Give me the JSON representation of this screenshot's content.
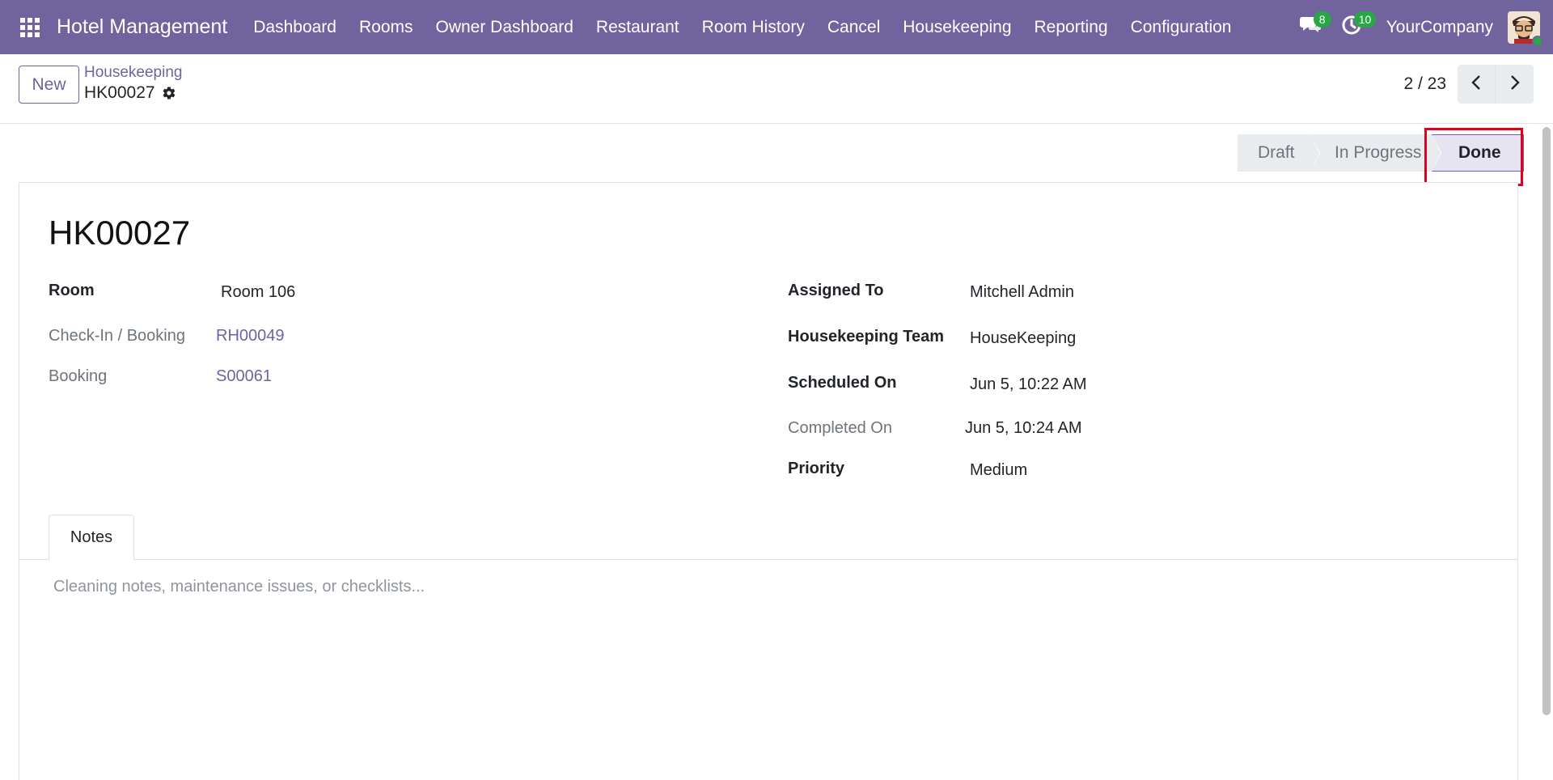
{
  "navbar": {
    "brand": "Hotel Management",
    "menu": [
      {
        "label": "Dashboard"
      },
      {
        "label": "Rooms"
      },
      {
        "label": "Owner Dashboard"
      },
      {
        "label": "Restaurant"
      },
      {
        "label": "Room History"
      },
      {
        "label": "Cancel"
      },
      {
        "label": "Housekeeping"
      },
      {
        "label": "Reporting"
      },
      {
        "label": "Configuration"
      }
    ],
    "messages_count": "8",
    "activities_count": "10",
    "company": "YourCompany",
    "accent_color": "#71639e",
    "badge_color": "#28a745"
  },
  "control_panel": {
    "new_label": "New",
    "breadcrumb_parent": "Housekeeping",
    "breadcrumb_current": "HK00027",
    "pager_value": "2 / 23"
  },
  "statusbar": {
    "stages": [
      {
        "label": "Draft",
        "active": false
      },
      {
        "label": "In Progress",
        "active": false
      },
      {
        "label": "Done",
        "active": true
      }
    ],
    "highlight_color": "#e0001b"
  },
  "form": {
    "title": "HK00027",
    "left_fields": [
      {
        "label": "Room",
        "value": "Room 106"
      },
      {
        "label": "Check-In / Booking",
        "value": "RH00049"
      },
      {
        "label": "Booking",
        "value": "S00061"
      }
    ],
    "right_fields": [
      {
        "label": "Assigned To",
        "value": "Mitchell Admin"
      },
      {
        "label": "Housekeeping Team",
        "value": "HouseKeeping"
      },
      {
        "label": "Scheduled On",
        "value": "Jun 5, 10:22 AM"
      },
      {
        "label": "Completed On",
        "value": "Jun 5, 10:24 AM"
      },
      {
        "label": "Priority",
        "value": "Medium"
      }
    ]
  },
  "notebook": {
    "tabs": [
      {
        "label": "Notes"
      }
    ],
    "notes_placeholder": "Cleaning notes, maintenance issues, or checklists..."
  }
}
